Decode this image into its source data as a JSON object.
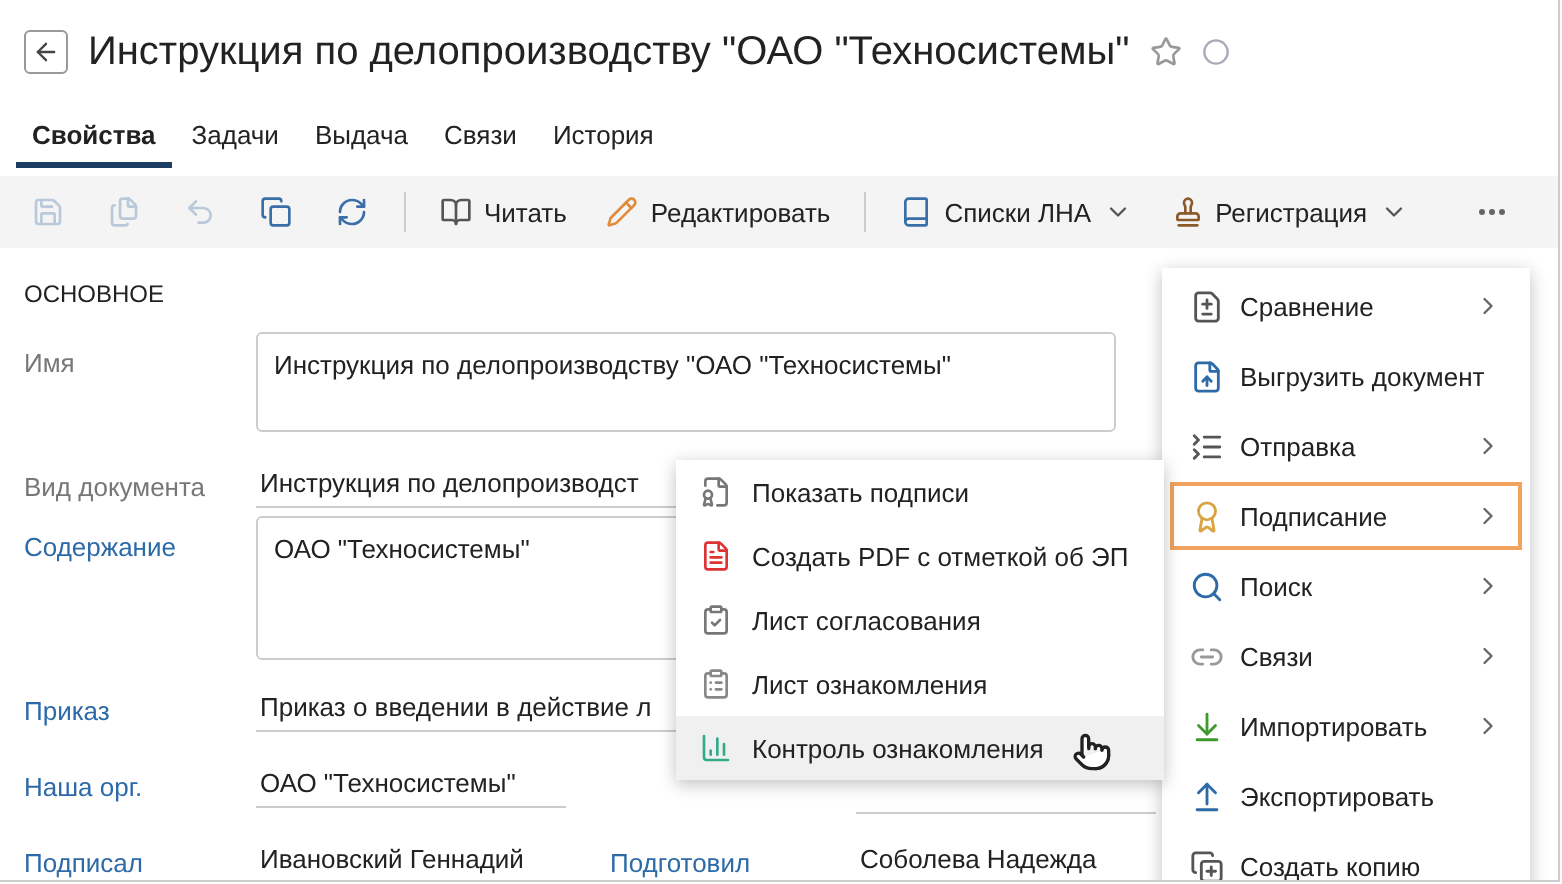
{
  "header": {
    "title": "Инструкция по делопроизводству \"ОАО \"Техносистемы\"",
    "favorite": false
  },
  "tabs": [
    {
      "label": "Свойства",
      "selected": true
    },
    {
      "label": "Задачи",
      "selected": false
    },
    {
      "label": "Выдача",
      "selected": false
    },
    {
      "label": "Связи",
      "selected": false
    },
    {
      "label": "История",
      "selected": false
    }
  ],
  "toolbar": {
    "icon_buttons": [
      {
        "disabled": true
      },
      {
        "disabled": true
      },
      {
        "disabled": true
      },
      {
        "disabled": false
      },
      {
        "disabled": false
      }
    ],
    "buttons": [
      {
        "label": "Читать",
        "dropdown": false
      },
      {
        "label": "Редактировать",
        "dropdown": false
      },
      {
        "label": "Списки ЛНА",
        "dropdown": true
      },
      {
        "label": "Регистрация",
        "dropdown": true
      }
    ]
  },
  "section": "ОСНОВНОЕ",
  "form": {
    "name": {
      "label": "Имя",
      "value": "Инструкция по делопроизводству \"ОАО \"Техносистемы\""
    },
    "doc_type": {
      "label": "Вид документа",
      "value": "Инструкция по делопроизводст"
    },
    "content": {
      "label": "Содержание",
      "value": "ОАО \"Техносистемы\""
    },
    "order": {
      "label": "Приказ",
      "value": "Приказ о введении в действие л"
    },
    "pairs": [
      [
        {
          "label": "Наша орг.",
          "value": "ОАО \"Техносистемы\""
        }
      ],
      [
        {
          "label": "Подписал",
          "value": "Ивановский Геннадий"
        },
        {
          "label": "Подготовил",
          "value": "Соболева Надежда"
        }
      ]
    ]
  },
  "menu": [
    {
      "label": "Сравнение",
      "submenu": true,
      "selected": false
    },
    {
      "label": "Выгрузить документ",
      "submenu": false,
      "selected": false
    },
    {
      "label": "Отправка",
      "submenu": true,
      "selected": false
    },
    {
      "label": "Подписание",
      "submenu": true,
      "selected": true
    },
    {
      "label": "Поиск",
      "submenu": true,
      "selected": false
    },
    {
      "label": "Связи",
      "submenu": true,
      "selected": false
    },
    {
      "label": "Импортировать",
      "submenu": true,
      "selected": false
    },
    {
      "label": "Экспортировать",
      "submenu": false,
      "selected": false
    },
    {
      "label": "Создать копию",
      "submenu": false,
      "selected": false
    }
  ],
  "submenu": [
    {
      "label": "Показать подписи",
      "hovered": false
    },
    {
      "label": "Создать PDF с отметкой об ЭП",
      "hovered": false
    },
    {
      "label": "Лист согласования",
      "hovered": false
    },
    {
      "label": "Лист ознакомления",
      "hovered": false
    },
    {
      "label": "Контроль ознакомления",
      "hovered": true
    }
  ]
}
